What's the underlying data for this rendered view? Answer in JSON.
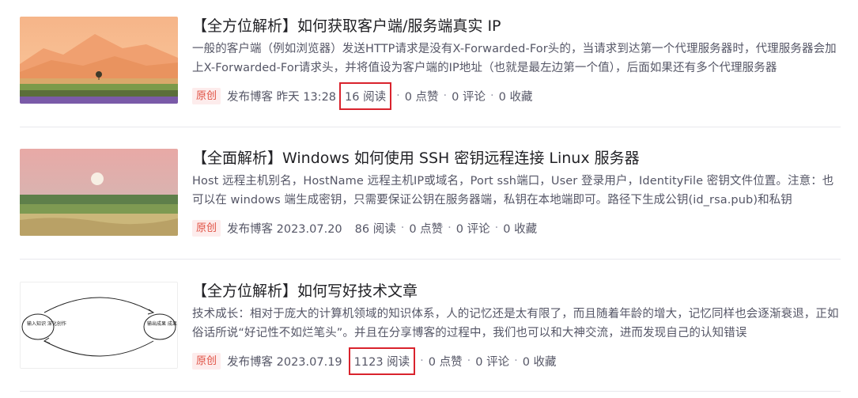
{
  "articles": [
    {
      "title": "【全方位解析】如何获取客户端/服务端真实 IP",
      "desc": "一般的客户端（例如浏览器）发送HTTP请求是没有X-Forwarded-For头的，当请求到达第一个代理服务器时，代理服务器会加上X-Forwarded-For请求头，并将值设为客户端的IP地址（也就是最左边第一个值），后面如果还有多个代理服务器",
      "badge": "原创",
      "publish": "发布博客 昨天 13:28",
      "reads": "16 阅读",
      "likes": "0 点赞",
      "comments": "0 评论",
      "favorites": "0 收藏",
      "thumb_icon": "desert-landscape-image"
    },
    {
      "title": "【全面解析】Windows 如何使用 SSH 密钥远程连接 Linux 服务器",
      "desc": "Host 远程主机别名，HostName 远程主机IP或域名，Port ssh端口，User 登录用户，IdentityFile 密钥文件位置。注意：也可以在 windows 端生成密钥，只需要保证公钥在服务器端，私钥在本地端即可。路径下生成公钥(id_rsa.pub)和私钥",
      "badge": "原创",
      "publish": "发布博客 2023.07.20",
      "reads": "86 阅读",
      "likes": "0 点赞",
      "comments": "0 评论",
      "favorites": "0 收藏",
      "thumb_icon": "moon-field-image"
    },
    {
      "title": "【全方位解析】如何写好技术文章",
      "desc": "技术成长：相对于庞大的计算机领域的知识体系，人的记忆还是太有限了，而且随着年龄的增大，记忆同样也会逐渐衰退，正如俗话所说“好记性不如烂笔头”。并且在分享博客的过程中，我们也可以和大神交流，进而发现自己的认知错误",
      "badge": "原创",
      "publish": "发布博客 2023.07.19",
      "reads": "1123 阅读",
      "likes": "0 点赞",
      "comments": "0 评论",
      "favorites": "0 收藏",
      "thumb_icon": "sketch-diagram-image",
      "thumb_left": "输入知识 深化创作",
      "thumb_right": "输出成果 成果反馈"
    }
  ],
  "colors": {
    "highlight": "#d9232d",
    "badge_bg": "#fdecec",
    "badge_text": "#e05244"
  }
}
